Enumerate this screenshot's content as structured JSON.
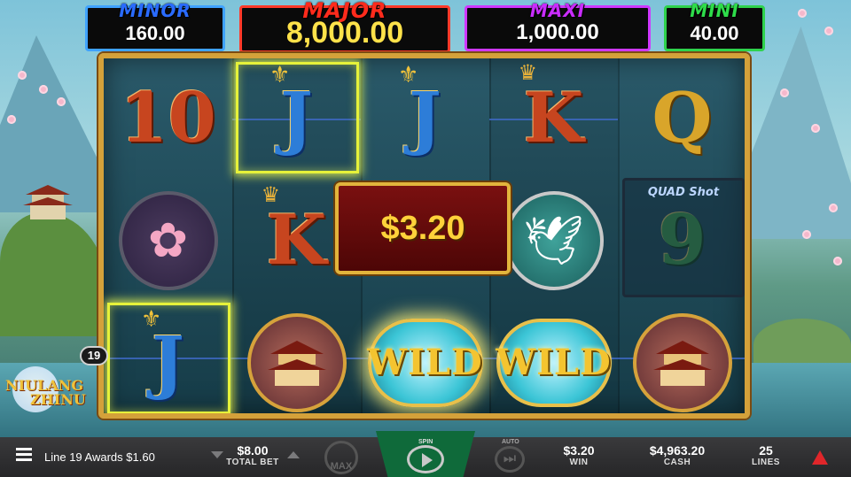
{
  "jackpots": {
    "minor": {
      "name": "MINOR",
      "value": "160.00"
    },
    "major": {
      "name": "MAJOR",
      "value": "8,000.00"
    },
    "maxi": {
      "name": "MAXI",
      "value": "1,000.00"
    },
    "mini": {
      "name": "MINI",
      "value": "40.00"
    }
  },
  "reels": {
    "row1": [
      "10",
      "J",
      "J",
      "K",
      "Q"
    ],
    "row2": [
      "flower",
      "K",
      "",
      "crane",
      "9"
    ],
    "row3": [
      "J",
      "pagoda",
      "WILD",
      "WILD",
      "pagoda"
    ]
  },
  "quad_label": "QUAD Shot",
  "win_amount": "$3.20",
  "line_badge": "19",
  "logo_text": {
    "line1": "NIULANG",
    "line2": "ZHINU"
  },
  "bottom_bar": {
    "message": "Line 19 Awards $1.60",
    "total_bet_value": "$8.00",
    "total_bet_label": "TOTAL BET",
    "max_label": "MAX",
    "spin_label": "SPIN",
    "auto_label": "AUTO",
    "win_value": "$3.20",
    "win_label": "WIN",
    "cash_value": "$4,963.20",
    "cash_label": "CASH",
    "lines_value": "25",
    "lines_label": "LINES"
  },
  "colors": {
    "minor": "#3fa2ff",
    "major": "#ff3a2a",
    "maxi": "#cf38ff",
    "mini": "#2ed24c",
    "frame": "#d4a13a",
    "highlight": "#e6f23a"
  }
}
